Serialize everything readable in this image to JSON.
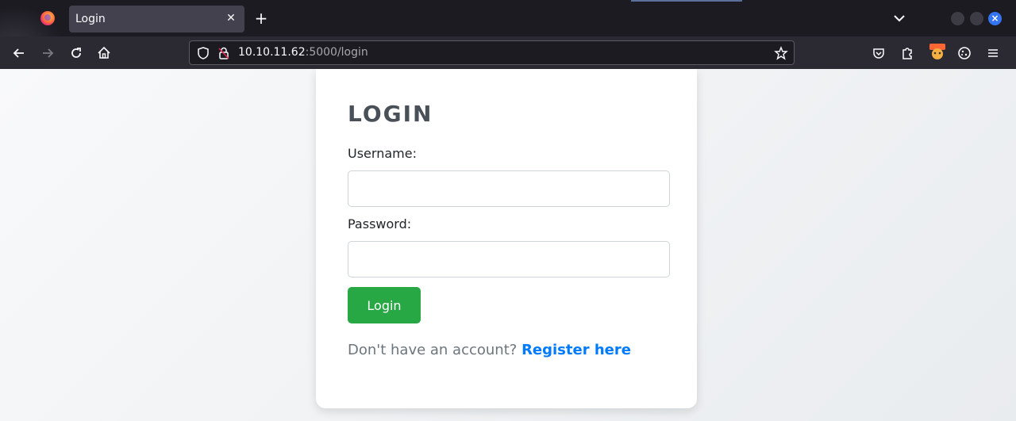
{
  "browser": {
    "tab_title": "Login",
    "url_host": "10.10.11.62",
    "url_rest": ":5000/login"
  },
  "page": {
    "heading": "LOGIN",
    "username_label": "Username:",
    "username_value": "",
    "password_label": "Password:",
    "password_value": "",
    "login_button": "Login",
    "register_prompt": "Don't have an account?",
    "register_link": "Register here"
  }
}
